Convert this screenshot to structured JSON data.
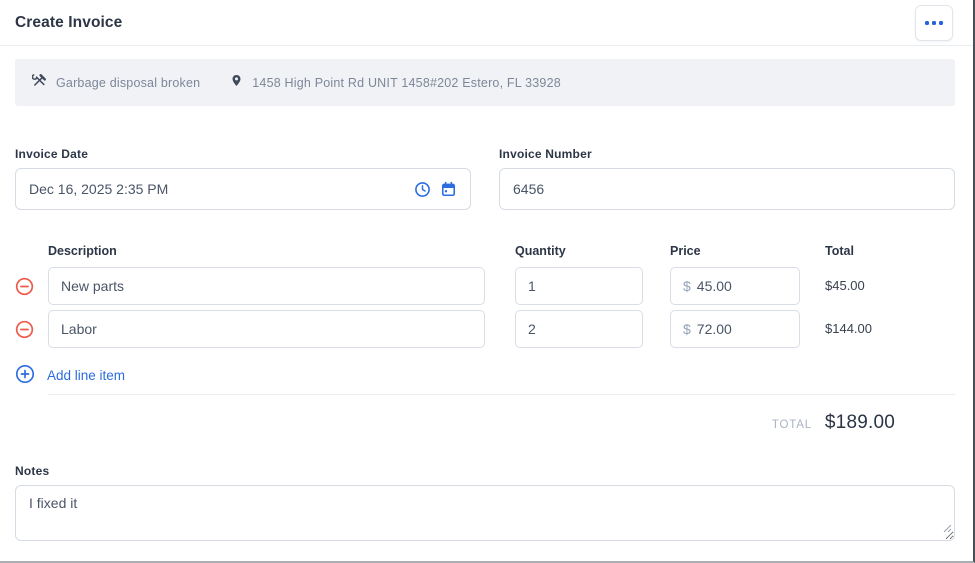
{
  "header": {
    "title": "Create Invoice"
  },
  "job_bar": {
    "job_title": "Garbage disposal broken",
    "address": "1458 High Point Rd UNIT 1458#202 Estero, FL 33928"
  },
  "fields": {
    "invoice_date": {
      "label": "Invoice Date",
      "value": "Dec 16, 2025 2:35 PM"
    },
    "invoice_number": {
      "label": "Invoice Number",
      "value": "6456"
    }
  },
  "line_items": {
    "headers": {
      "description": "Description",
      "quantity": "Quantity",
      "price": "Price",
      "total": "Total"
    },
    "currency_symbol": "$",
    "rows": [
      {
        "description": "New parts",
        "quantity": "1",
        "price": "45.00",
        "total": "$45.00"
      },
      {
        "description": "Labor",
        "quantity": "2",
        "price": "72.00",
        "total": "$144.00"
      }
    ],
    "add_line_item_label": "Add line item"
  },
  "summary": {
    "total_label": "TOTAL",
    "total_amount": "$189.00"
  },
  "notes": {
    "label": "Notes",
    "value": "I fixed it"
  },
  "icons": {
    "menu": "ellipsis-icon",
    "job": "tools-icon",
    "location": "location-pin-icon",
    "date_time": "clock-icon",
    "date_calendar": "calendar-icon",
    "remove_row": "minus-circle-icon",
    "add_row": "plus-circle-icon",
    "resize": "resize-grip-icon"
  },
  "colors": {
    "accent_blue": "#2c6de0",
    "remove_red": "#ee5a4b",
    "text_dark": "#2d3748",
    "text_muted": "#7d8799",
    "job_bar_bg": "#f1f2f6"
  }
}
